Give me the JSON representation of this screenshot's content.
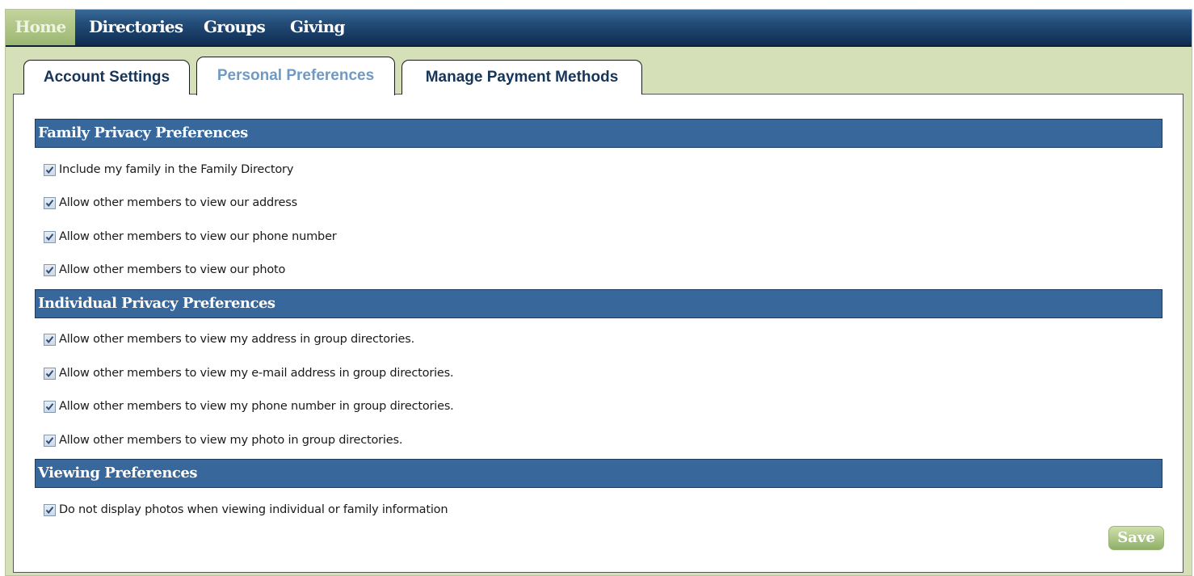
{
  "nav": {
    "home": "Home",
    "directories": "Directories",
    "groups": "Groups",
    "giving": "Giving"
  },
  "tabs": [
    {
      "label": "Account Settings",
      "active": false
    },
    {
      "label": "Personal Preferences",
      "active": true
    },
    {
      "label": "Manage Payment Methods",
      "active": false
    }
  ],
  "sections": [
    {
      "title": "Family Privacy Preferences",
      "items": [
        {
          "label": "Include my family in the Family Directory",
          "checked": true
        },
        {
          "label": "Allow other members to view our address",
          "checked": true
        },
        {
          "label": "Allow other members to view our phone number",
          "checked": true
        },
        {
          "label": "Allow other members to view our photo",
          "checked": true
        }
      ]
    },
    {
      "title": "Individual Privacy Preferences",
      "items": [
        {
          "label": "Allow other members to view my address in group directories.",
          "checked": true
        },
        {
          "label": "Allow other members to view my e-mail address in group directories.",
          "checked": true
        },
        {
          "label": "Allow other members to view my phone number in group directories.",
          "checked": true
        },
        {
          "label": "Allow other members to view my photo in group directories.",
          "checked": true
        }
      ]
    },
    {
      "title": "Viewing Preferences",
      "items": [
        {
          "label": "Do not display photos when viewing individual or family information",
          "checked": true
        }
      ]
    }
  ],
  "save_label": "Save",
  "colors": {
    "nav_bg": "#1b3f69",
    "home_bg": "#9cb672",
    "section_header": "#37679b",
    "outer_bg": "#d6e0b8",
    "save_btn": "#a9c482"
  }
}
